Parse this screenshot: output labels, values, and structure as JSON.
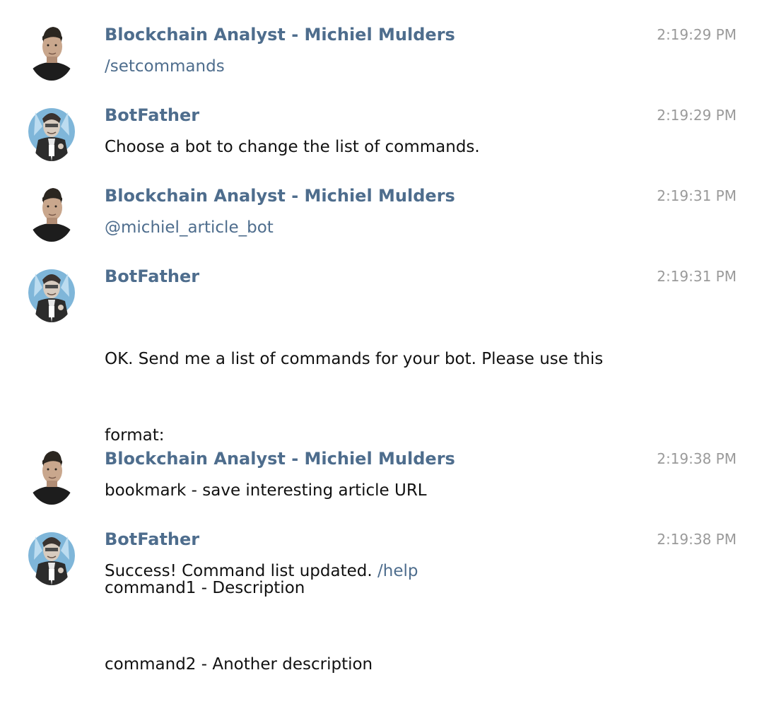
{
  "messages": [
    {
      "sender": "Blockchain Analyst - Michiel Mulders",
      "avatar": "michiel-avatar",
      "time": "2:19:29 PM",
      "text": "/setcommands",
      "is_link": true
    },
    {
      "sender": "BotFather",
      "avatar": "botfather-avatar",
      "time": "2:19:29 PM",
      "text": "Choose a bot to change the list of commands.",
      "is_link": false
    },
    {
      "sender": "Blockchain Analyst - Michiel Mulders",
      "avatar": "michiel-avatar",
      "time": "2:19:31 PM",
      "text": "@michiel_article_bot",
      "is_link": true
    },
    {
      "sender": "BotFather",
      "avatar": "botfather-avatar",
      "time": "2:19:31 PM",
      "text_lines": [
        "OK. Send me a list of commands for your bot. Please use this",
        "format:",
        "",
        "command1 - Description",
        "command2 - Another description"
      ],
      "is_link": false
    },
    {
      "sender": "Blockchain Analyst - Michiel Mulders",
      "avatar": "michiel-avatar",
      "time": "2:19:38 PM",
      "text": "bookmark - save interesting article URL",
      "is_link": false
    },
    {
      "sender": "BotFather",
      "avatar": "botfather-avatar",
      "time": "2:19:38 PM",
      "text": "Success! Command list updated.",
      "link_text": "/help",
      "is_link": false
    }
  ],
  "colors": {
    "sender": "#4e6d8d",
    "text": "#111111",
    "time": "#9a9a9a",
    "link": "#4e6d8d",
    "botfather_bg": "#7fb6d9"
  }
}
